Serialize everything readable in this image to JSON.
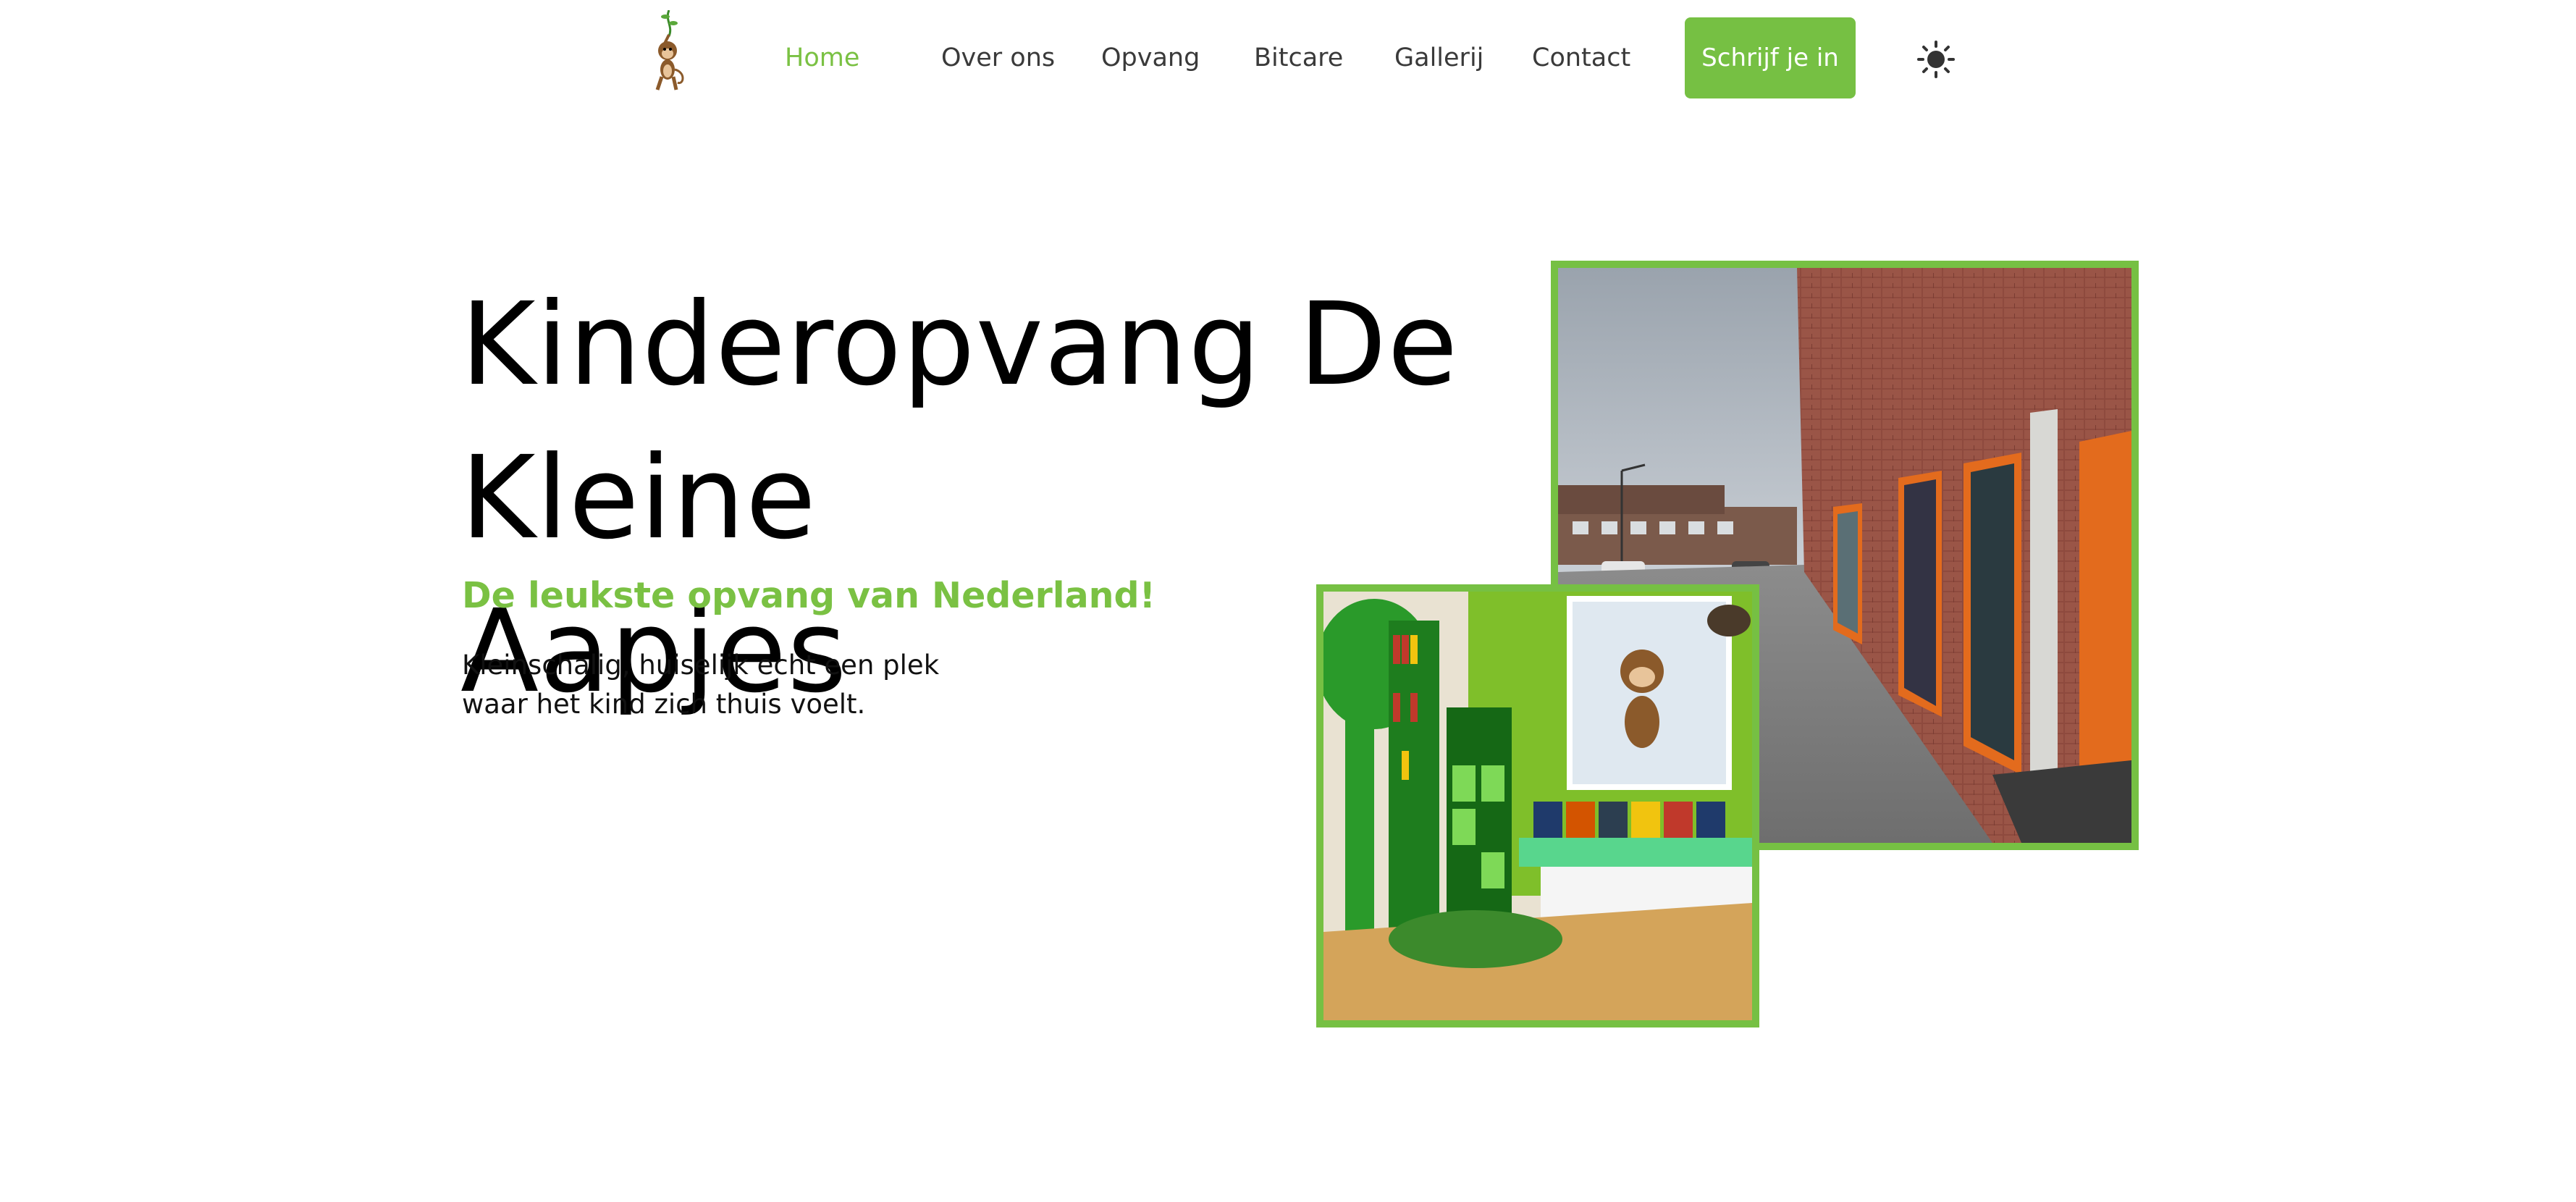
{
  "header": {
    "logo_icon": "monkey-hanging-from-vine-logo",
    "nav": [
      {
        "label": "Home",
        "active": true
      },
      {
        "label": "Over ons",
        "active": false
      },
      {
        "label": "Opvang",
        "active": false
      },
      {
        "label": "Bitcare",
        "active": false
      },
      {
        "label": "Gallerij",
        "active": false
      },
      {
        "label": "Contact",
        "active": false
      }
    ],
    "cta_label": "Schrijf je in",
    "theme_icon": "sun-icon"
  },
  "hero": {
    "title_line1": "Kinderopvang De Kleine",
    "title_line2": "Aapjes",
    "subtitle": "De leukste opvang van Nederland!",
    "text_line1": "Kleinschalig, huiselijk echt een plek",
    "text_line2": "waar het kind zich thuis voelt."
  },
  "colors": {
    "accent": "#76c043",
    "nav_text": "#3a3a3a",
    "heading": "#000000"
  }
}
